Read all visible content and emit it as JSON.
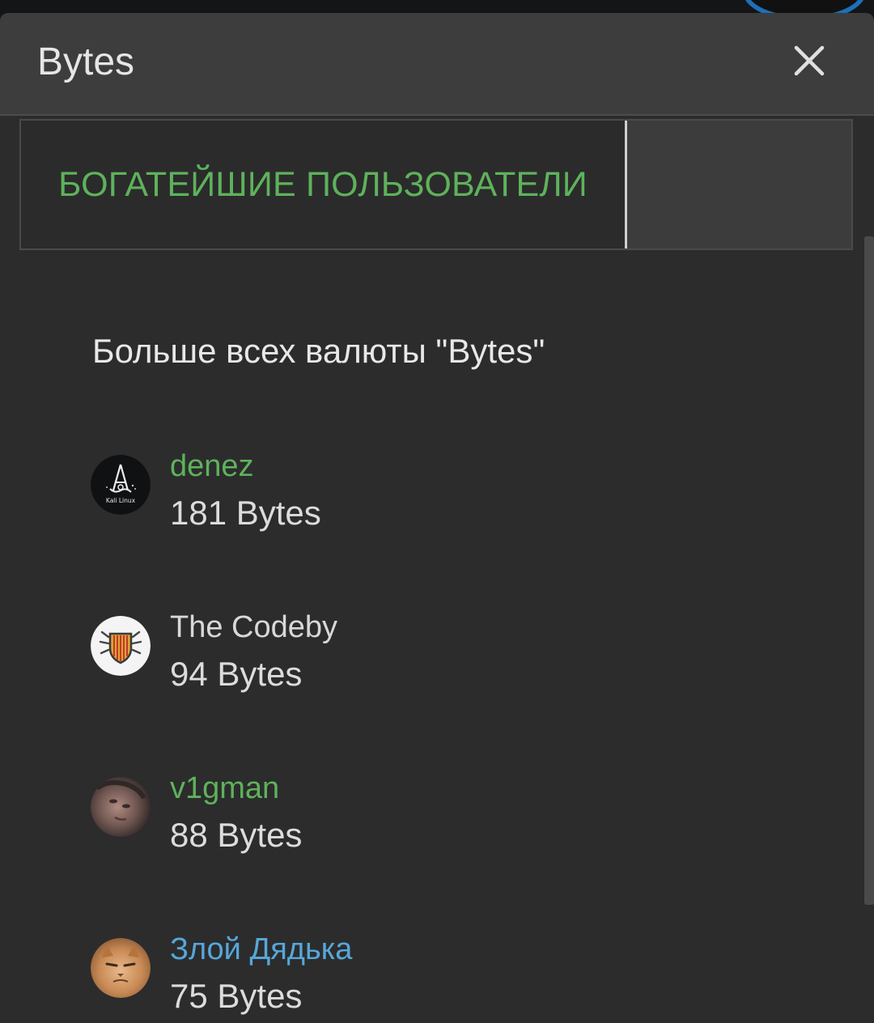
{
  "dialog": {
    "title": "Bytes",
    "close_icon": "close-icon"
  },
  "tabs": [
    {
      "label": "БОГАТЕЙШИЕ ПОЛЬЗОВАТЕЛИ",
      "active": true
    }
  ],
  "section": {
    "heading": "Больше всех валюты \"Bytes\""
  },
  "users": [
    {
      "name": "denez",
      "amount": "181 Bytes",
      "name_color": "#5eb25b",
      "avatar_icon": "kali-linux-avatar",
      "avatar_caption": "Kali Linux"
    },
    {
      "name": "The Codeby",
      "amount": "94 Bytes",
      "name_color": "#d8d8d8",
      "avatar_icon": "codeby-shield-avatar"
    },
    {
      "name": "v1gman",
      "amount": "88 Bytes",
      "name_color": "#5eb25b",
      "avatar_icon": "face-photo-avatar"
    },
    {
      "name": "Злой Дядька",
      "amount": "75 Bytes",
      "name_color": "#56a7da",
      "avatar_icon": "cat-photo-avatar"
    }
  ],
  "colors": {
    "accent_green": "#5eb25b",
    "accent_blue": "#56a7da",
    "header_bg": "#3d3d3e",
    "dialog_bg": "#2c2c2d"
  }
}
